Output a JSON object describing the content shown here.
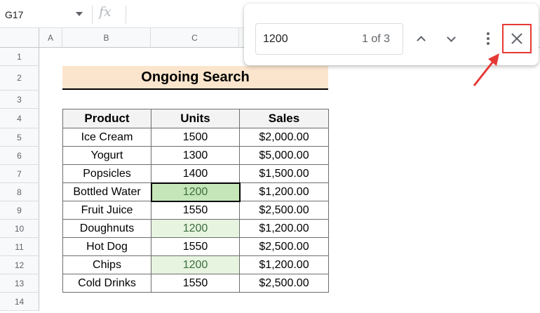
{
  "formula_bar": {
    "name_box": "G17",
    "fx": "fx"
  },
  "columns": [
    "A",
    "B",
    "C"
  ],
  "rows": [
    "1",
    "2",
    "3",
    "4",
    "5",
    "6",
    "7",
    "8",
    "9",
    "10",
    "11",
    "12",
    "13",
    "14"
  ],
  "title": "Ongoing Search",
  "table": {
    "headers": [
      "Product",
      "Units",
      "Sales"
    ],
    "rows": [
      [
        "Ice Cream",
        "1500",
        "$2,000.00"
      ],
      [
        "Yogurt",
        "1300",
        "$5,000.00"
      ],
      [
        "Popsicles",
        "1400",
        "$1,500.00"
      ],
      [
        "Bottled Water",
        "1200",
        "$1,200.00"
      ],
      [
        "Fruit Juice",
        "1550",
        "$2,500.00"
      ],
      [
        "Doughnuts",
        "1200",
        "$1,200.00"
      ],
      [
        "Hot Dog",
        "1550",
        "$2,500.00"
      ],
      [
        "Chips",
        "1200",
        "$1,200.00"
      ],
      [
        "Cold Drinks",
        "1550",
        "$2,500.00"
      ]
    ]
  },
  "find": {
    "query": "1200",
    "count": "1 of 3"
  },
  "colors": {
    "title_bg": "#fce5cd",
    "match_bg": "#e6f4e0",
    "current_match_bg": "#c5e6b8",
    "highlight": "#e53935"
  }
}
